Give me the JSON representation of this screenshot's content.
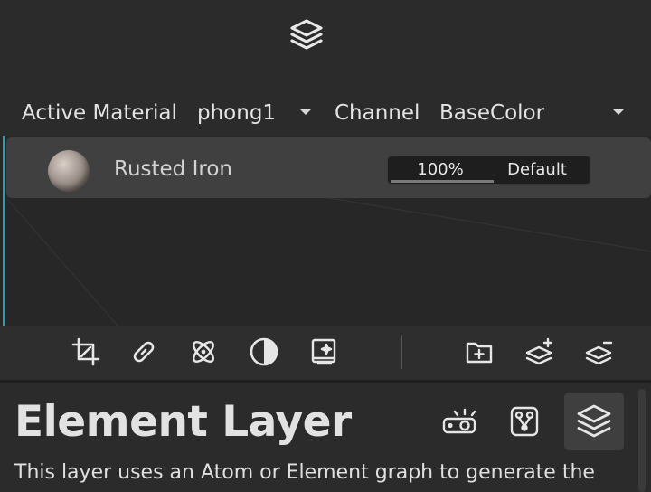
{
  "header": {
    "logo_icon": "layers-stack-icon",
    "active_material_label": "Active Material",
    "active_material_value": "phong1",
    "channel_label": "Channel",
    "channel_value": "BaseColor"
  },
  "layers": [
    {
      "name": "Rusted Iron",
      "thumbnail": "rusted-iron-sphere",
      "opacity": "100%",
      "blend_mode": "Default"
    }
  ],
  "toolbar": {
    "left_icons": [
      "crop-icon",
      "link-icon",
      "atom-icon",
      "contrast-icon",
      "sparkle-image-icon"
    ],
    "right_icons": [
      "add-folder-icon",
      "add-layer-icon",
      "remove-layer-icon"
    ]
  },
  "panel": {
    "title": "Element Layer",
    "description": "This layer uses an Atom or Element graph to generate the",
    "icons": [
      "projector-icon",
      "node-graph-icon",
      "layers-icon"
    ],
    "active_icon": "layers-icon"
  },
  "colors": {
    "accent": "#2aa0b8",
    "background": "#2b2b2b",
    "selected_row": "#404040"
  }
}
